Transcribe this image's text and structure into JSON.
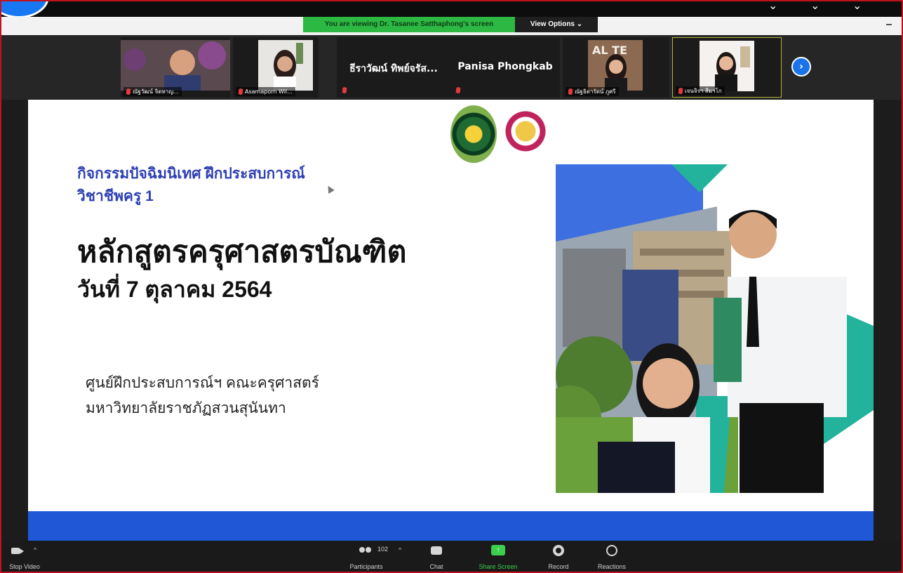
{
  "share_banner": {
    "text": "You are viewing Dr. Tasanee Satthaphong's screen",
    "view_options_label": "View Options ⌄"
  },
  "gallery": {
    "participants": [
      {
        "name": "ณัฐวัฒน์ จิตหาญ..."
      },
      {
        "name": "Asamaporn Wil..."
      },
      {
        "name": "ธีราวัฒน์ ทิพย์จรัส..."
      },
      {
        "name": "Panisa Phongkab"
      },
      {
        "name": "ณัฐธิดารัตน์ ภูศรี"
      },
      {
        "name": "เจนจิรา สีมาโก"
      }
    ],
    "next_label": "›"
  },
  "slide": {
    "eyebrow_line1": "กิจกรรมปัจฉิมนิเทศ ฝึกประสบการณ์",
    "eyebrow_line2": "วิชาชีพครู 1",
    "title": "หลักสูตรครุศาสตรบัณฑิต",
    "date": "วันที่ 7 ตุลาคม 2564",
    "org_line1": "ศูนย์ฝึกประสบการณ์ฯ คณะครุศาสตร์",
    "org_line2": "มหาวิทยาลัยราชภัฏสวนสุนันทา",
    "accent_color": "#1f57d6",
    "teal_color": "#23b39c"
  },
  "toolbar": {
    "stop_video_label": "Stop Video",
    "participants_label": "Participants",
    "participants_count": "102",
    "chat_label": "Chat",
    "share_screen_label": "Share Screen",
    "record_label": "Record",
    "reactions_label": "Reactions",
    "share_color": "#3ccf4e"
  }
}
